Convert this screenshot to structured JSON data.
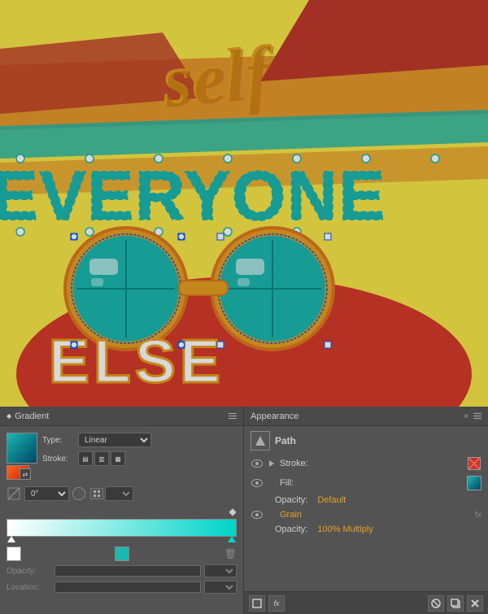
{
  "canvas": {
    "bg_color": "#f9e84a",
    "text_self": "self",
    "text_everyone": "everyone",
    "text_else": "ELSE"
  },
  "gradient_panel": {
    "title": "Gradient",
    "type_label": "Type:",
    "type_value": "Linear",
    "stroke_label": "Stroke:",
    "angle_value": "0°",
    "opacity_label": "Opacity:",
    "location_label": "Location:"
  },
  "appearance_panel": {
    "title": "Appearance",
    "path_label": "Path",
    "stroke_label": "Stroke:",
    "fill_label": "Fill:",
    "opacity_label": "Opacity:",
    "opacity_value": "Default",
    "grain_label": "Grain",
    "fx_label": "fx",
    "multiply_label": "Opacity:",
    "multiply_value": "100% Multiply"
  },
  "icons": {
    "diamond": "◆",
    "eye": "👁",
    "play": "▶",
    "fx": "fx",
    "trash": "🗑",
    "menu": "☰",
    "new_layer": "□",
    "clear": "✕",
    "expand": "»"
  }
}
